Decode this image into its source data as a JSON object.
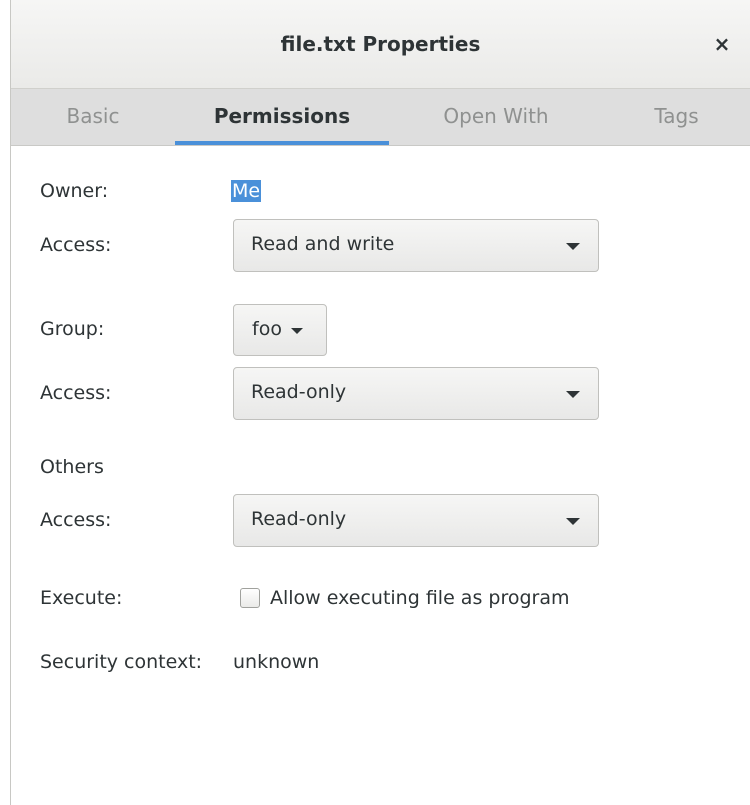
{
  "window": {
    "title": "file.txt Properties",
    "close_icon": "×"
  },
  "tabs": [
    {
      "label": "Basic",
      "active": false
    },
    {
      "label": "Permissions",
      "active": true
    },
    {
      "label": "Open With",
      "active": false
    },
    {
      "label": "Tags",
      "active": false
    }
  ],
  "owner": {
    "label": "Owner:",
    "value": "Me",
    "access_label": "Access:",
    "access_value": "Read and write"
  },
  "group": {
    "label": "Group:",
    "value": "foo",
    "access_label": "Access:",
    "access_value": "Read-only"
  },
  "others": {
    "label": "Others",
    "access_label": "Access:",
    "access_value": "Read-only"
  },
  "execute": {
    "label": "Execute:",
    "checkbox_label": "Allow executing file as program",
    "checked": false
  },
  "security": {
    "label": "Security context:",
    "value": "unknown"
  },
  "colors": {
    "accent": "#4a90d9",
    "text": "#2e3436",
    "inactive_tab": "#8f9190"
  }
}
